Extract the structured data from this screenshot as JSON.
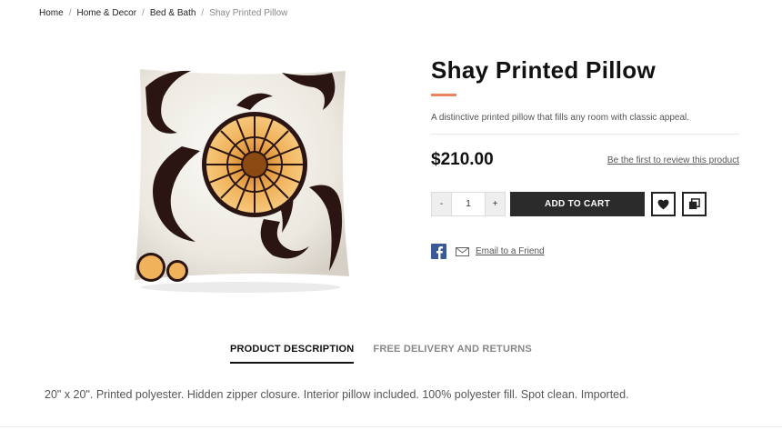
{
  "breadcrumb": {
    "home": "Home",
    "category": "Home & Decor",
    "subcategory": "Bed & Bath",
    "current": "Shay Printed Pillow",
    "separator": "/"
  },
  "product": {
    "name": "Shay Printed Pillow",
    "short_description": "A distinctive printed pillow that fills any room with classic appeal.",
    "price": "$210.00",
    "review_link": "Be the first to review this product",
    "quantity": "1",
    "qty_minus": "-",
    "qty_plus": "+",
    "add_to_cart": "ADD TO CART",
    "email_friend": "Email to a Friend"
  },
  "tabs": {
    "description": "PRODUCT DESCRIPTION",
    "delivery": "FREE DELIVERY AND RETURNS"
  },
  "description_text": "20\" x 20\". Printed polyester. Hidden zipper closure. Interior pillow included. 100% polyester fill. Spot clean. Imported.",
  "colors": {
    "accent": "#e8845f",
    "button": "#2b2b2b",
    "facebook": "#3b5998"
  },
  "icons": [
    "heart-icon",
    "compare-icon",
    "facebook-icon",
    "mail-icon"
  ]
}
